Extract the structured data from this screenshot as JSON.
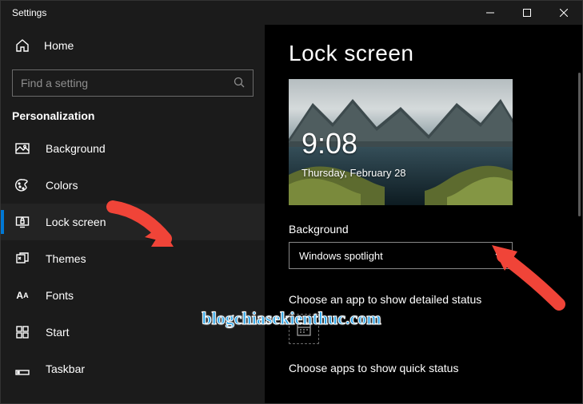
{
  "window": {
    "title": "Settings"
  },
  "sidebar": {
    "home_label": "Home",
    "search_placeholder": "Find a setting",
    "category": "Personalization",
    "items": [
      {
        "label": "Background",
        "selected": false,
        "icon": "image"
      },
      {
        "label": "Colors",
        "selected": false,
        "icon": "palette"
      },
      {
        "label": "Lock screen",
        "selected": true,
        "icon": "lockscreen"
      },
      {
        "label": "Themes",
        "selected": false,
        "icon": "themes"
      },
      {
        "label": "Fonts",
        "selected": false,
        "icon": "fonts"
      },
      {
        "label": "Start",
        "selected": false,
        "icon": "start"
      },
      {
        "label": "Taskbar",
        "selected": false,
        "icon": "taskbar"
      }
    ]
  },
  "main": {
    "page_title": "Lock screen",
    "preview": {
      "time": "9:08",
      "date": "Thursday, February 28"
    },
    "background": {
      "label": "Background",
      "selected": "Windows spotlight"
    },
    "detailed_status_label": "Choose an app to show detailed status",
    "quick_status_label": "Choose apps to show quick status"
  },
  "watermark": "blogchiasekienthuc.com"
}
